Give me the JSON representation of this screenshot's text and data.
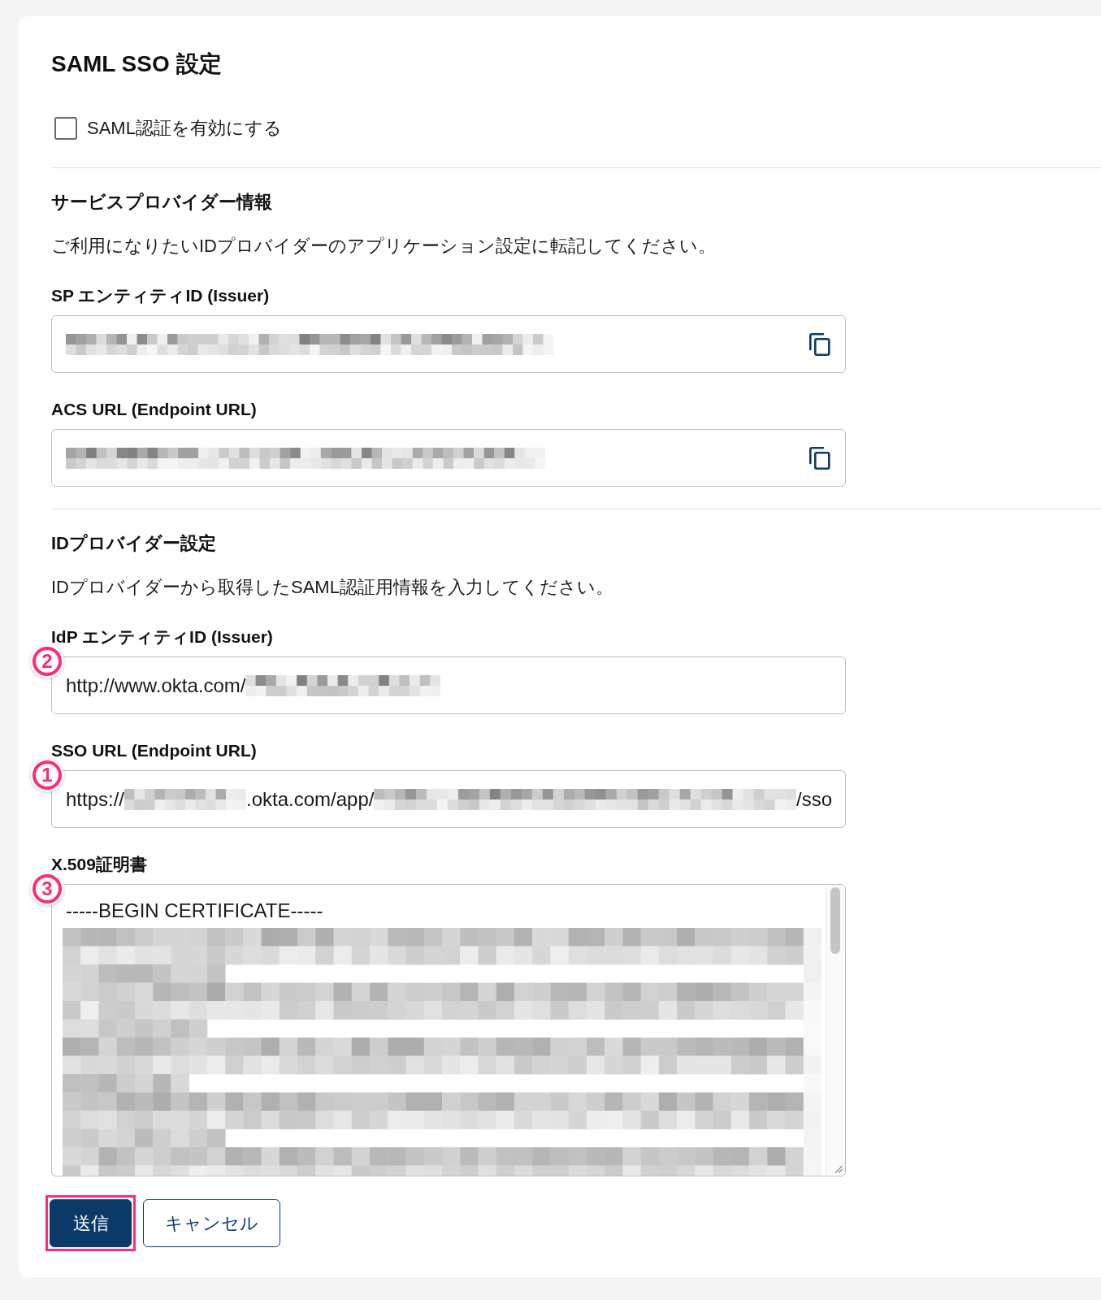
{
  "title": "SAML SSO 設定",
  "enable_saml": {
    "label": "SAML認証を有効にする",
    "checked": false
  },
  "sections": [
    {
      "heading": "サービスプロバイダー情報",
      "description": "ご利用になりたいIDプロバイダーのアプリケーション設定に転記してください。",
      "fields": [
        {
          "kind": "copy",
          "label": "SP エンティティID (Issuer)",
          "value": [
            {
              "kind": "redacted"
            }
          ]
        },
        {
          "kind": "copy",
          "label": "ACS URL (Endpoint URL)",
          "value": [
            {
              "kind": "redacted"
            }
          ]
        }
      ]
    },
    {
      "heading": "IDプロバイダー設定",
      "description": "IDプロバイダーから取得したSAML認証用情報を入力してください。",
      "fields": [
        {
          "kind": "input",
          "label": "IdP エンティティID (Issuer)",
          "callout": "2",
          "value": [
            {
              "kind": "text",
              "text": "http://www.okta.com/"
            },
            {
              "kind": "redacted"
            }
          ]
        },
        {
          "kind": "input",
          "label": "SSO URL (Endpoint URL)",
          "callout": "1",
          "value": [
            {
              "kind": "text",
              "text": "https://"
            },
            {
              "kind": "redacted"
            },
            {
              "kind": "text",
              "text": ".okta.com/app/"
            },
            {
              "kind": "redacted"
            },
            {
              "kind": "text",
              "text": "/sso"
            }
          ]
        },
        {
          "kind": "textarea",
          "label": "X.509証明書",
          "callout": "3",
          "value": [
            {
              "kind": "text",
              "text": "-----BEGIN CERTIFICATE-----"
            },
            {
              "kind": "redacted"
            }
          ]
        }
      ]
    }
  ],
  "buttons": [
    {
      "kind": "primary",
      "label": "送信",
      "highlighted": true
    },
    {
      "kind": "secondary",
      "label": "キャンセル",
      "highlighted": false
    }
  ]
}
